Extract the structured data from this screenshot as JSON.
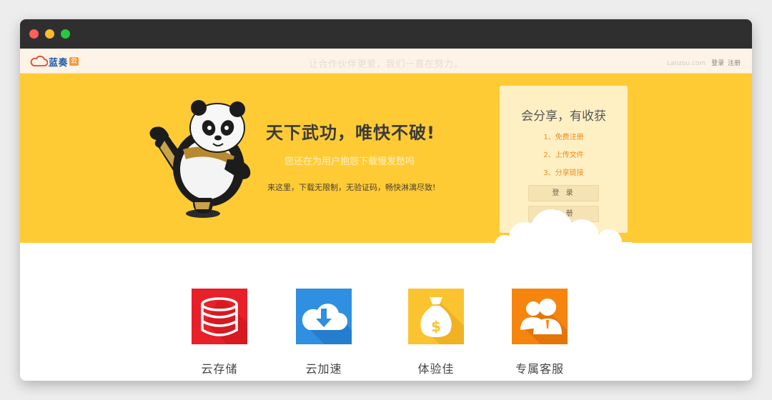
{
  "window": {
    "controls": [
      "close",
      "minimize",
      "zoom"
    ]
  },
  "topnav": {
    "logo_text": "蓝奏",
    "logo_badge": "云",
    "slogan": "让合作伙伴更爱，我们一直在努力。",
    "site": "Lanzou.com",
    "login_link": "登录",
    "register_link": "注册"
  },
  "hero": {
    "headline": "天下武功，唯快不破!",
    "subline": "您还在为用户抱怨下载慢发愁吗",
    "description": "来这里，下载无限制，无验证码，畅快淋漓尽致!"
  },
  "share_box": {
    "title": "会分享，有收获",
    "steps": [
      "1、免费注册",
      "2、上传文件",
      "3、分享链接"
    ],
    "login_button": "登 录",
    "register_button": "注 册"
  },
  "features": [
    {
      "label": "云存储",
      "icon": "database-icon",
      "color": "#e8202a"
    },
    {
      "label": "云加速",
      "icon": "cloud-download-icon",
      "color": "#2f8fe0"
    },
    {
      "label": "体验佳",
      "icon": "money-bag-icon",
      "color": "#fcc330"
    },
    {
      "label": "专属客服",
      "icon": "customer-service-icon",
      "color": "#f6850f"
    }
  ],
  "colors": {
    "hero_bg": "#ffcb35",
    "nav_bg": "#fdf3e7",
    "accent_orange": "#ef8a1a",
    "brand_blue": "#1e5aa8"
  }
}
